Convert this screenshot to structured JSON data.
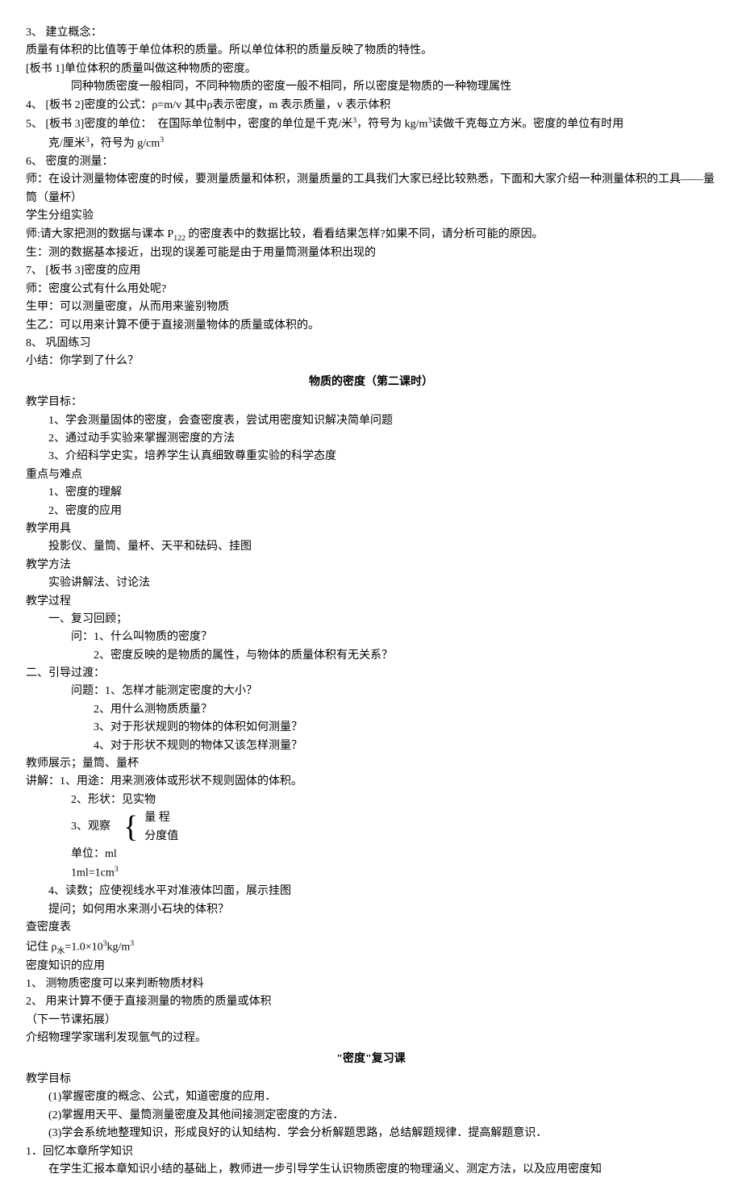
{
  "s1": {
    "l1": "3、 建立概念：",
    "l2": "质量有体积的比值等于单位体积的质量。所以单位体积的质量反映了物质的特性。",
    "l3": "[板书 1]单位体积的质量叫做这种物质的密度。",
    "l4": "同种物质密度一般相同，不同种物质的密度一般不相同，所以密度是物质的一种物理属性",
    "l5": "4、 [板书 2]密度的公式：ρ=m/v 其中ρ表示密度，m 表示质量，v 表示体积",
    "l6a": "5、 [板书 3]密度的单位：  在国际单位制中，密度的单位是千克/米",
    "l6b": "，符号为 kg/m",
    "l6c": "读做千克每立方米。密度的单位有时用",
    "l7a": "克/厘米",
    "l7b": "，符号为 g/cm",
    "l8": "6、 密度的测量：",
    "l9": "师：在设计测量物体密度的时候，要测量质量和体积，测量质量的工具我们大家已经比较熟悉，下面和大家介绍一种测量体积的工具——量筒（量杯）",
    "l10": "学生分组实验",
    "l11a": "师:请大家把测的数据与课本 P",
    "l11b": " 的密度表中的数据比较，看看结果怎样?如果不同，请分析可能的原因。",
    "l12": "生：测的数据基本接近，出现的误差可能是由于用量筒测量体积出现的",
    "l13": "7、 [板书 3]密度的应用",
    "l14": "师：密度公式有什么用处呢?",
    "l15": "生甲：可以测量密度，从而用来鉴别物质",
    "l16": "生乙：可以用来计算不便于直接测量物体的质量或体积的。",
    "l17": "8、 巩固练习",
    "l18": "小结：你学到了什么？"
  },
  "h1": "物质的密度（第二课时）",
  "s2": {
    "l1": "教学目标：",
    "l2": "1、学会测量固体的密度，会查密度表，尝试用密度知识解决简单问题",
    "l3": "2、通过动手实验来掌握测密度的方法",
    "l4": "3、介绍科学史实，培养学生认真细致尊重实验的科学态度",
    "l5": "重点与难点",
    "l6": "1、密度的理解",
    "l7": "2、密度的应用",
    "l8": "教学用具",
    "l9": "投影仪、量筒、量杯、天平和砝码、挂图",
    "l10": "教学方法",
    "l11": "实验讲解法、讨论法",
    "l12": "教学过程",
    "l13": "一、复习回顾；",
    "l14": "问：1、什么叫物质的密度？",
    "l15": "2、密度反映的是物质的属性，与物体的质量体积有无关系？",
    "l16": "二、引导过渡：",
    "l17": "问题：1、怎样才能测定密度的大小？",
    "l18": "2、用什么测物质质量？",
    "l19": "3、对于形状规则的物体的体积如何测量？",
    "l20": "4、对于形状不规则的物体又该怎样测量？",
    "l21": "教师展示；量筒、量杯",
    "l22": "讲解：1、用途：用来测液体或形状不规则固体的体积。",
    "l23": "2、形状：见实物",
    "l24": "3、观察",
    "b1": "量    程",
    "b2": "分度值",
    "l25": "单位：ml",
    "l26a": "1ml=1cm",
    "l27": "4、读数；应使视线水平对准液体凹面，展示挂图",
    "l28": "提问；如何用水来测小石块的体积？",
    "l29": "查密度表",
    "l30a": "记住 ρ",
    "l30b": "=1.0×10",
    "l30c": "kg/m",
    "l31": "密度知识的应用",
    "l32": "1、 测物质密度可以来判断物质材料",
    "l33": "2、 用来计算不便于直接测量的物质的质量或体积",
    "l34": "（下一节课拓展）",
    "l35": "介绍物理学家瑞利发现氩气的过程。"
  },
  "h2": "\"密度\"复习课",
  "s3": {
    "l1": "教学目标",
    "l2": "(1)掌握密度的概念、公式，知道密度的应用．",
    "l3": "(2)掌握用天平、量筒测量密度及其他间接测定密度的方法．",
    "l4": "(3)学会系统地整理知识，形成良好的认知结构．学会分析解题思路，总结解题规律．提高解题意识．",
    "l5": "1．回忆本章所学知识",
    "l6": "在学生汇报本章知识小结的基础上，教师进一步引导学生认识物质密度的物理涵义、测定方法，以及应用密度知"
  },
  "sup3": "3",
  "sub122": "122",
  "subwater": "水"
}
